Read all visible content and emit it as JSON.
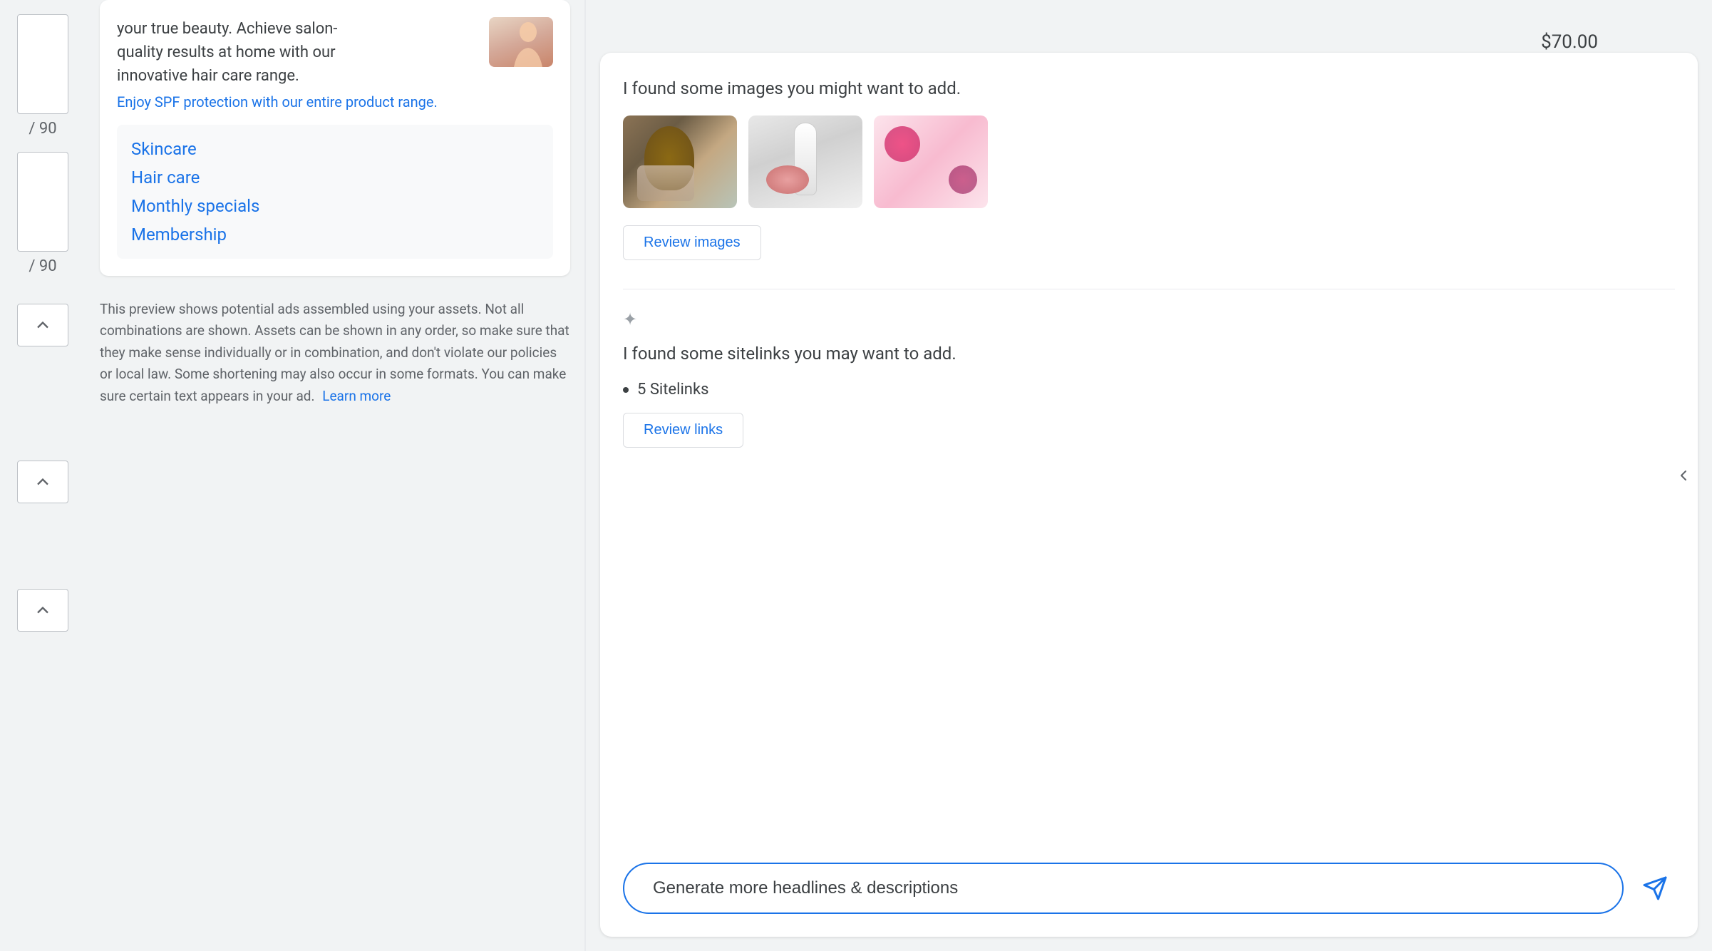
{
  "left": {
    "counter1_label": "/ 90",
    "counter2_label": "/ 90",
    "ad_description": "your true beauty. Achieve salon-quality results at home with our innovative hair care range.",
    "ad_promo_link": "Enjoy SPF protection with our entire product range.",
    "nav_links": [
      "Skincare",
      "Hair care",
      "Monthly specials",
      "Membership"
    ],
    "disclaimer": "This preview shows potential ads assembled using your assets. Not all combinations are shown. Assets can be shown in any order, so make sure that they make sense individually or in combination, and don't violate our policies or local law. Some shortening may also occur in some formats. You can make sure certain text appears in your ad.",
    "learn_more": "Learn more"
  },
  "right": {
    "price": "$70.00",
    "images_section": {
      "title": "I found some images you might want to add.",
      "review_button": "Review images"
    },
    "sitelinks_section": {
      "title": "I found some sitelinks you may want to add.",
      "count_label": "5 Sitelinks",
      "review_button": "Review links"
    },
    "generate_button": "Generate more headlines & descriptions",
    "send_icon": "send-icon",
    "collapse_icon": "chevron-left-icon",
    "sparkle_icon": "✦"
  }
}
